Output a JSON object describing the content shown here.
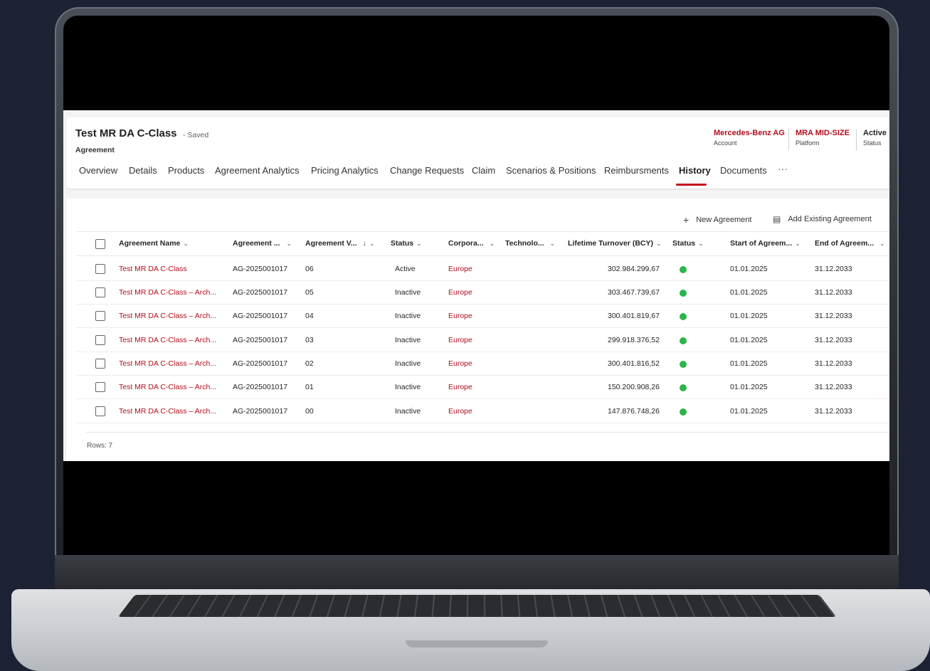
{
  "record": {
    "title": "Test MR DA C-Class",
    "saved": "- Saved",
    "entity": "Agreement",
    "fields": [
      {
        "value": "Mercedes-Benz AG",
        "label": "Account",
        "color": "#b10e1c"
      },
      {
        "value": "MRA MID-SIZE",
        "label": "Platform",
        "color": "#b10e1c"
      },
      {
        "value": "Active",
        "label": "Status",
        "color": "#1f1f1f"
      }
    ]
  },
  "tabs": [
    "Overview",
    "Details",
    "Products",
    "Agreement Analytics",
    "Pricing Analytics",
    "Change Requests",
    "Claim",
    "Scenarios & Positions",
    "Reimbursments",
    "History",
    "Documents"
  ],
  "active_tab": "History",
  "more_label": "···",
  "commands": {
    "new_agreement": "New Agreement",
    "add_existing": "Add Existing Agreement"
  },
  "columns": [
    "Agreement Name",
    "Agreement ...",
    "Agreement V...",
    "Status",
    "Corpora...",
    "Technolo...",
    "Lifetime Turnover (BCY)",
    "Status",
    "Start of Agreem...",
    "End of Agreem..."
  ],
  "sort_indicator": "↓",
  "rows": [
    {
      "name": "Test MR DA C-Class",
      "id": "AG-2025001017",
      "version": "06",
      "status": "Active",
      "corp": "Europe",
      "tech": "",
      "turnover": "302.984.299,67",
      "start": "01.01.2025",
      "end": "31.12.2033"
    },
    {
      "name": "Test MR DA C-Class – Arch...",
      "id": "AG-2025001017",
      "version": "05",
      "status": "Inactive",
      "corp": "Europe",
      "tech": "",
      "turnover": "303.467.739,67",
      "start": "01.01.2025",
      "end": "31.12.2033"
    },
    {
      "name": "Test MR DA C-Class – Arch...",
      "id": "AG-2025001017",
      "version": "04",
      "status": "Inactive",
      "corp": "Europe",
      "tech": "",
      "turnover": "300.401.819,67",
      "start": "01.01.2025",
      "end": "31.12.2033"
    },
    {
      "name": "Test MR DA C-Class – Arch...",
      "id": "AG-2025001017",
      "version": "03",
      "status": "Inactive",
      "corp": "Europe",
      "tech": "",
      "turnover": "299.918.376,52",
      "start": "01.01.2025",
      "end": "31.12.2033"
    },
    {
      "name": "Test MR DA C-Class – Arch...",
      "id": "AG-2025001017",
      "version": "02",
      "status": "Inactive",
      "corp": "Europe",
      "tech": "",
      "turnover": "300.401.816,52",
      "start": "01.01.2025",
      "end": "31.12.2033"
    },
    {
      "name": "Test MR DA C-Class – Arch...",
      "id": "AG-2025001017",
      "version": "01",
      "status": "Inactive",
      "corp": "Europe",
      "tech": "",
      "turnover": "150.200.908,26",
      "start": "01.01.2025",
      "end": "31.12.2033"
    },
    {
      "name": "Test MR DA C-Class – Arch...",
      "id": "AG-2025001017",
      "version": "00",
      "status": "Inactive",
      "corp": "Europe",
      "tech": "",
      "turnover": "147.876.748,26",
      "start": "01.01.2025",
      "end": "31.12.2033"
    }
  ],
  "footer": {
    "rows_label": "Rows: 7"
  },
  "colors": {
    "accent": "#b10e1c",
    "status_dot": "#2db54b",
    "tab_underline": "#c50f1f"
  }
}
